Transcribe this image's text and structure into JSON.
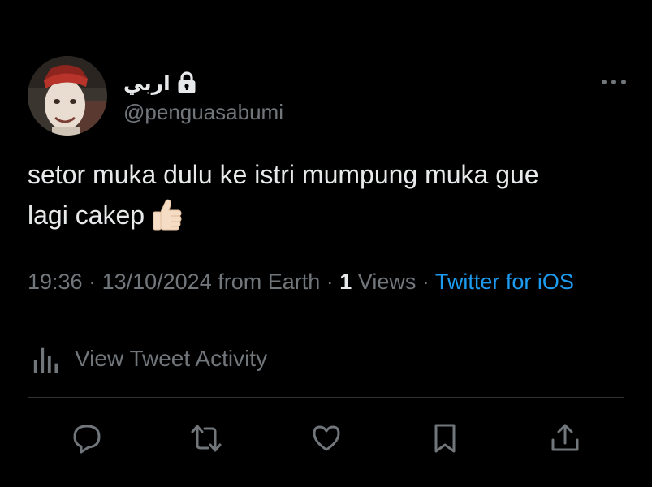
{
  "tweet": {
    "author": {
      "display_name": "اربي",
      "handle": "@penguasabumi",
      "locked": true
    },
    "text_line1": "setor muka dulu ke istri mumpung muka gue",
    "text_line2": "lagi cakep",
    "emoji": "thumbs-up-light-skin-tone",
    "meta": {
      "time": "19:36",
      "sep1": " · ",
      "date": "13/10/2024",
      "location": " from Earth",
      "sep2": " · ",
      "views_count": "1",
      "views_label": " Views",
      "sep3": " · ",
      "source": "Twitter for iOS"
    }
  },
  "activity": {
    "label": "View Tweet Activity"
  },
  "colors": {
    "background": "#000000",
    "text_primary": "#e7e9ea",
    "text_secondary": "#71767b",
    "link": "#1d9bf0",
    "divider": "#2f3336"
  }
}
